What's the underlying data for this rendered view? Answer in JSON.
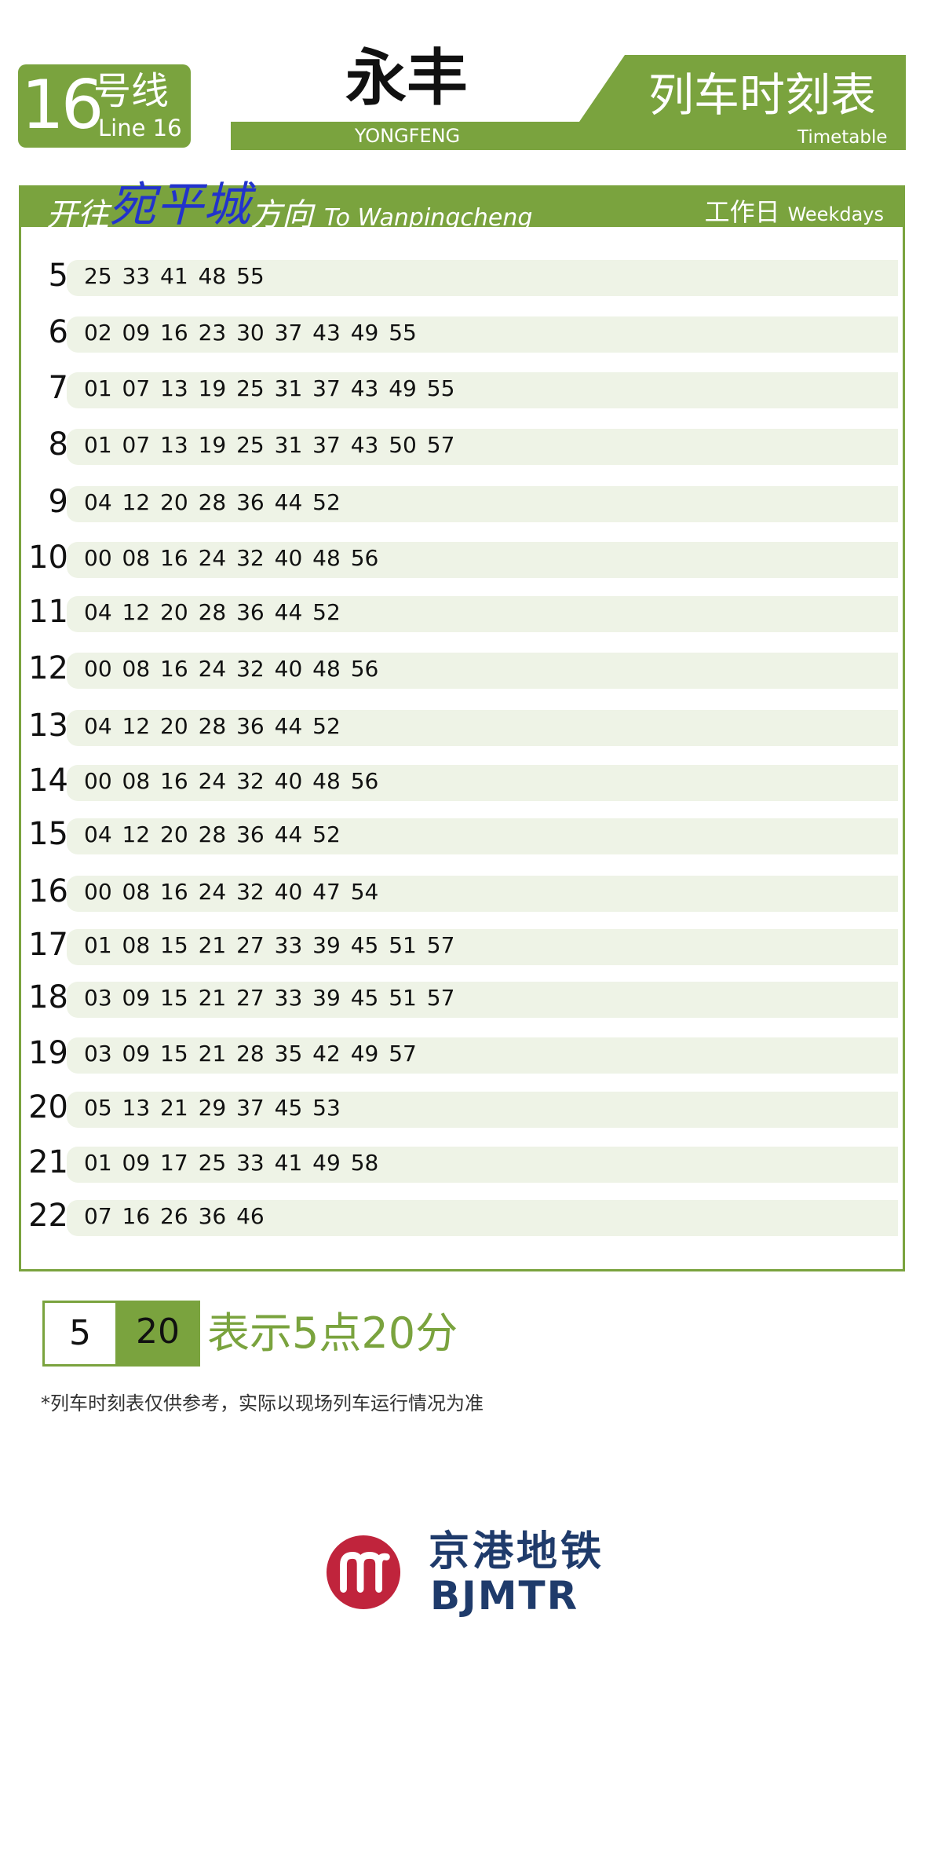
{
  "header": {
    "line_number": "16",
    "line_label_cn": "号线",
    "line_label_en": "Line 16",
    "station_cn": "永丰",
    "station_en": "YONGFENG",
    "title_cn": "列车时刻表",
    "title_en": "Timetable"
  },
  "direction": {
    "prefix": "开往",
    "destination": "宛平城",
    "suffix": "方向",
    "english": "To Wanpingcheng",
    "day_cn": "工作日",
    "day_en": "Weekdays"
  },
  "timetable": [
    {
      "hour": "5",
      "minutes": "25 33 41 48 55"
    },
    {
      "hour": "6",
      "minutes": "02 09 16 23 30 37 43 49 55"
    },
    {
      "hour": "7",
      "minutes": "01 07 13 19 25 31 37 43 49 55"
    },
    {
      "hour": "8",
      "minutes": "01 07 13 19 25 31 37 43 50 57"
    },
    {
      "hour": "9",
      "minutes": "04 12 20 28 36 44 52"
    },
    {
      "hour": "10",
      "minutes": "00 08 16 24 32 40 48 56"
    },
    {
      "hour": "11",
      "minutes": "04 12 20 28 36 44 52"
    },
    {
      "hour": "12",
      "minutes": "00 08 16 24 32 40 48 56"
    },
    {
      "hour": "13",
      "minutes": "04 12 20 28 36 44 52"
    },
    {
      "hour": "14",
      "minutes": "00 08 16 24 32 40 48 56"
    },
    {
      "hour": "15",
      "minutes": "04 12 20 28 36 44 52"
    },
    {
      "hour": "16",
      "minutes": "00 08 16 24 32 40 47 54"
    },
    {
      "hour": "17",
      "minutes": "01 08 15 21 27 33 39 45 51 57"
    },
    {
      "hour": "18",
      "minutes": "03 09 15 21 27 33 39 45 51 57"
    },
    {
      "hour": "19",
      "minutes": "03 09 15 21 28 35 42 49 57"
    },
    {
      "hour": "20",
      "minutes": "05 13 21 29 37 45 53"
    },
    {
      "hour": "21",
      "minutes": "01 09 17 25 33 41 49 58"
    },
    {
      "hour": "22",
      "minutes": "07 16 26 36 46"
    }
  ],
  "legend": {
    "hour_example": "5",
    "minute_example": "20",
    "meaning": "表示5点20分"
  },
  "note": "*列车时刻表仅供参考，实际以现场列车运行情况为准",
  "logo": {
    "name_cn": "京港地铁",
    "name_en": "BJMTR",
    "icon": "bjmtr-logo-icon"
  },
  "colors": {
    "accent_green": "#7aa33e",
    "row_band": "#eef3e6",
    "destination_blue": "#2233cc",
    "logo_red": "#c0243c",
    "logo_navy": "#1f3b6b"
  }
}
